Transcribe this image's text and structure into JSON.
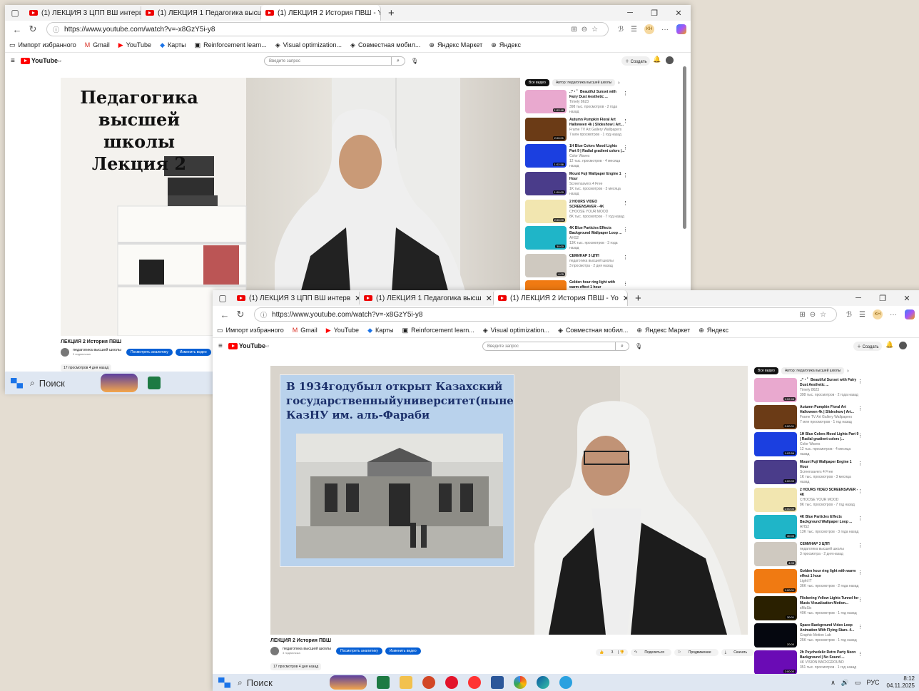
{
  "tabs": [
    {
      "label": "(1) ЛЕКЦИЯ 3 ЦПП ВШ интерв"
    },
    {
      "label": "(1) ЛЕКЦИЯ 1 Педагогика высш"
    },
    {
      "label": "(1) ЛЕКЦИЯ 2 История ПВШ - Yo"
    }
  ],
  "url": "https://www.youtube.com/watch?v=-x8GzY5i-y8",
  "profile_initials": "KH",
  "bookmarks": [
    "Импорт избранного",
    "Gmail",
    "YouTube",
    "Карты",
    "Reinforcement learn...",
    "Visual optimization...",
    "Совместная мобил...",
    "Яндекс Маркет",
    "Яндекс"
  ],
  "yt": {
    "logo": "YouTube",
    "logo_sup": "KZ",
    "search_placeholder": "Введите запрос",
    "create": "Создать",
    "chip_all": "Все видео",
    "chip_author": "Автор: педагогика высшей школы",
    "video_title": "ЛЕКЦИЯ 2 История ПВШ",
    "channel": "педагогика высшей школы",
    "subs": "3 подписчика",
    "btn_analytics": "Посмотреть аналитику",
    "btn_edit": "Изменить видео",
    "views": "17 просмотров  4 дня назад",
    "likes": "3",
    "share": "Поделиться",
    "promote": "Продвижение",
    "download": "Скачать"
  },
  "slide1": {
    "line1": "Педагогика",
    "line2": "высшей школы",
    "line3": "Лекция 2"
  },
  "slide2": {
    "text": "В 1934годубыл открыт Казахский государственныйуниверситет(ныне КазНУ им. аль-Фараби"
  },
  "recs": [
    {
      "title": ".:*・゜Beautiful Sunset with Fairy Dust Aesthetic ...",
      "channel": "Timely 8623",
      "meta": "398 тыс. просмотров · 2 года назад",
      "dur": "1:02:46",
      "color": "#e9a9cf"
    },
    {
      "title": "Autumn Pumpkin Floral Art Halloween 4k | Slideshow | Art...",
      "channel": "Frame TV Art Gallery Wallpapers",
      "meta": "7 млн просмотров · 1 год назад",
      "dur": "2:00:01",
      "color": "#6b3b16"
    },
    {
      "title": "1H Blue Colors Mood Lights Part 9 | Radial gradient colors |...",
      "channel": "Color Waves",
      "meta": "12 тыс. просмотров · 4 месяца назад",
      "dur": "1:02:56",
      "color": "#1b3fe0"
    },
    {
      "title": "Mount Fuji Wallpaper Engine 1 Hour",
      "channel": "Screensavers 4 Free",
      "meta": "1K тыс. просмотров · 3 месяца назад",
      "dur": "1:00:00",
      "color": "#4a3c8a"
    },
    {
      "title": "2 HOURS VIDEO SCREENSAVER - 4K",
      "channel": "CHOOSE YOUR MOOD",
      "meta": "8K тыс. просмотров · 7 год назад",
      "dur": "2:00:00",
      "color": "#f2e6b0"
    },
    {
      "title": "4K Blue Particles Effects Background Wallpaper Loop ...",
      "channel": "AHS2",
      "meta": "13K тыс. просмотров · 3 года назад",
      "dur": "30:00",
      "color": "#1fb5c8"
    },
    {
      "title": "СЕМИНАР 3 ЦПП",
      "channel": "педагогика высшей школы",
      "meta": "3 просмотра · 2 дня назад",
      "dur": "4:05",
      "color": "#cfc9c0"
    },
    {
      "title": "Golden hour ring light with warm effect 1 hour",
      "channel": "Light IT",
      "meta": "36K тыс. просмотров · 2 года назад",
      "dur": "1:00:01",
      "color": "#f07a12"
    },
    {
      "title": "Flickering Yellow Lights Tunnel for Music Visualization Motion...",
      "channel": "sMuSic",
      "meta": "40K тыс. просмотров · 1 год назад",
      "dur": "30:01",
      "color": "#2a2000"
    },
    {
      "title": "Space Background Video Loop Animation With Flying Stars. 4...",
      "channel": "Graphic Motion Lab",
      "meta": "25K тыс. просмотров · 1 год назад",
      "dur": "20:00",
      "color": "#05070f"
    },
    {
      "title": "2h Psychedelic Retro Party Neon Background | No Sound ...",
      "channel": "4K VISION BACKGROUND",
      "meta": "351 тыс. просмотров · 1 год назад",
      "dur": "2:00:00",
      "color": "#6a0bb5"
    }
  ],
  "taskbar": {
    "search": "Поиск",
    "lang": "РУС",
    "time": "8:12",
    "date": "04.11.2025"
  }
}
